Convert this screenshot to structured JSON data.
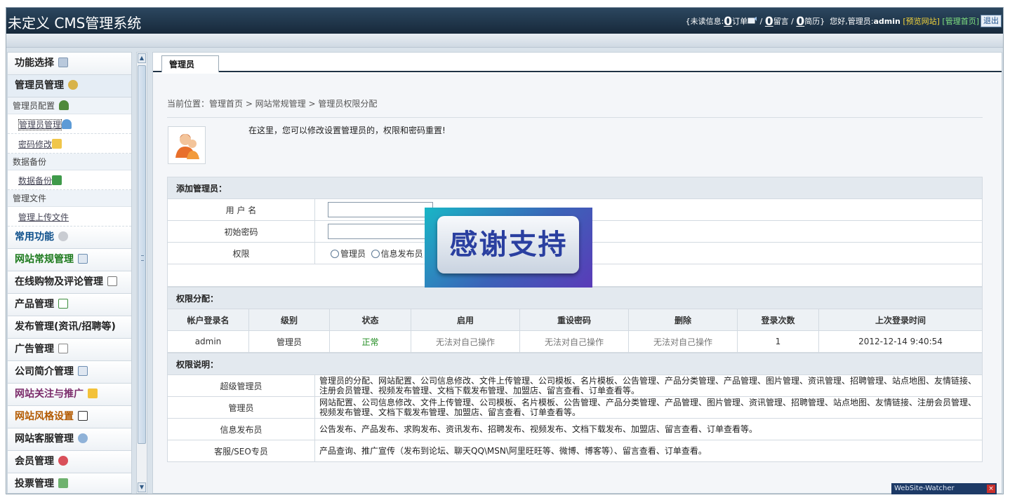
{
  "header": {
    "title": "未定义 CMS管理系统",
    "unread_prefix": "{未读信息:",
    "orders_count": "0",
    "orders_label": "订单",
    "messages_count": "0",
    "messages_label": "留言",
    "resumes_count": "0",
    "resumes_label": "简历}",
    "greeting": "您好,管理员:",
    "admin_name": "admin",
    "preview_link": "[预览网站]",
    "home_link": "[管理首页]",
    "logout": "退出"
  },
  "sidebar": {
    "func_select": "功能选择",
    "admin_mgmt": "管理员管理",
    "groups": [
      {
        "head": "管理员配置",
        "items": [
          "管理员管理",
          "密码修改"
        ]
      },
      {
        "head": "数据备份",
        "items": [
          "数据备份"
        ]
      },
      {
        "head": "管理文件",
        "items": [
          "管理上传文件"
        ]
      }
    ],
    "menus": [
      "常用功能",
      "网站常规管理",
      "在线购物及评论管理",
      "产品管理",
      "发布管理(资讯/招聘等)",
      "广告管理",
      "公司简介管理",
      "网站关注与推广",
      "网站风格设置",
      "网站客服管理",
      "会员管理",
      "投票管理"
    ]
  },
  "main": {
    "tab": "管理员",
    "breadcrumb": "当前位置：管理首页 > 网站常规管理 > 管理员权限分配",
    "tip": "在这里，您可以修改设置管理员的，权限和密码重置!",
    "add_section": "添加管理员：",
    "username_label": "用 户 名",
    "password_label": "初始密码",
    "permission_label": "权限",
    "radio_admin": "管理员",
    "radio_publisher": "信息发布员",
    "assign_section": "权限分配：",
    "columns": [
      "帐户登录名",
      "级别",
      "状态",
      "启用",
      "重设密码",
      "删除",
      "登录次数",
      "上次登录时间"
    ],
    "row": [
      "admin",
      "管理员",
      "正常",
      "无法对自己操作",
      "无法对自己操作",
      "无法对自己操作",
      "1",
      "2012-12-14 9:40:54"
    ],
    "desc_section": "权限说明：",
    "roles": [
      {
        "name": "超级管理员",
        "desc": "管理员的分配、网站配置、公司信息修改、文件上传管理、公司模板、名片模板、公告管理、产品分类管理、产品管理、图片管理、资讯管理、招聘管理、站点地图、友情链接、注册会员管理、视频发布管理、文档下载发布管理、加盟店、留言查看、订单查看等。"
      },
      {
        "name": "管理员",
        "desc": "网站配置、公司信息修改、文件上传管理、公司模板、名片模板、公告管理、产品分类管理、产品管理、图片管理、资讯管理、招聘管理、站点地图、友情链接、注册会员管理、视频发布管理、文档下载发布管理、加盟店、留言查看、订单查看等。"
      },
      {
        "name": "信息发布员",
        "desc": "公告发布、产品发布、求购发布、资讯发布、招聘发布、视频发布、文档下载发布、加盟店、留言查看、订单查看等。"
      },
      {
        "name": "客服/SEO专员",
        "desc": "产品查询、推广宣传（发布到论坛、聊天QQ\\MSN\\阿里旺旺等、微博、博客等）、留言查看、订单查看。"
      }
    ]
  },
  "overlay": {
    "text": "感谢支持"
  },
  "watcher": {
    "label": "WebSite-Watcher",
    "close": "×"
  }
}
